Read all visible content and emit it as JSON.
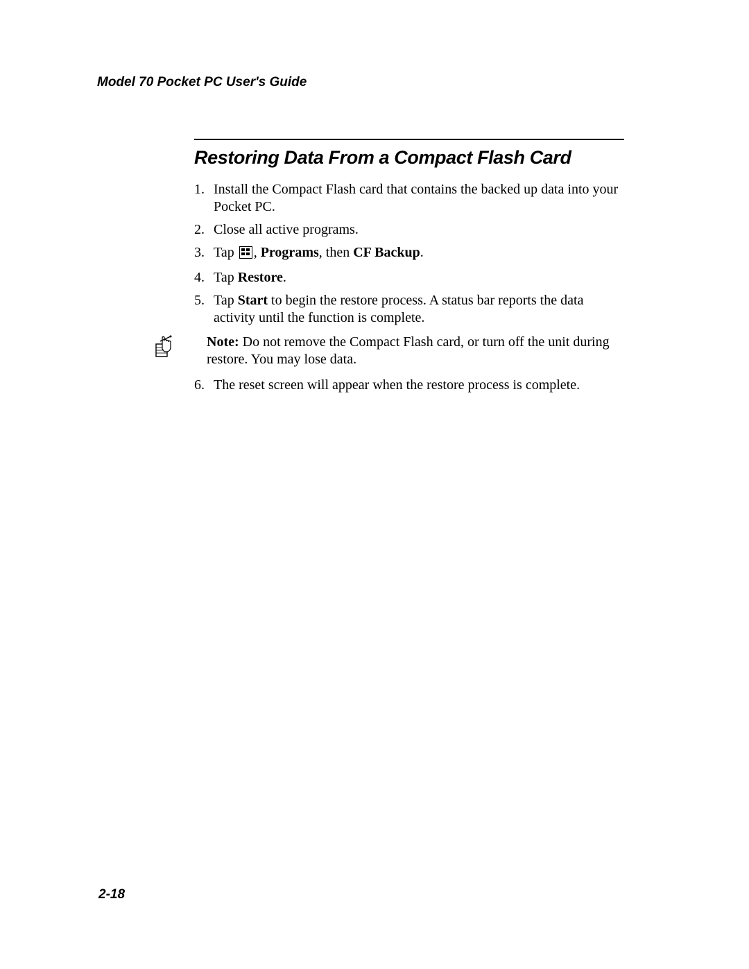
{
  "header": {
    "running": "Model 70 Pocket PC User's Guide"
  },
  "section": {
    "title": "Restoring Data From a Compact Flash Card"
  },
  "steps": {
    "s1": {
      "num": "1.",
      "text": "Install the Compact Flash card that contains the backed up data into your Pocket PC."
    },
    "s2": {
      "num": "2.",
      "text": "Close all active programs."
    },
    "s3": {
      "num": "3.",
      "pre": "Tap ",
      "post_comma": ", ",
      "bold1": "Programs",
      "mid": ", then ",
      "bold2": "CF Backup",
      "end": "."
    },
    "s4": {
      "num": "4.",
      "pre": "Tap ",
      "bold1": "Restore",
      "end": "."
    },
    "s5": {
      "num": "5.",
      "pre": "Tap ",
      "bold1": "Start",
      "post": " to begin the restore process. A status bar reports the data activity until the function is complete."
    },
    "s6": {
      "num": "6.",
      "text": " The reset screen will appear when the restore process is complete."
    }
  },
  "note": {
    "label": "Note:",
    "text": " Do not remove the Compact Flash card, or turn off the unit during restore. You may lose data."
  },
  "footer": {
    "page": "2-18"
  }
}
